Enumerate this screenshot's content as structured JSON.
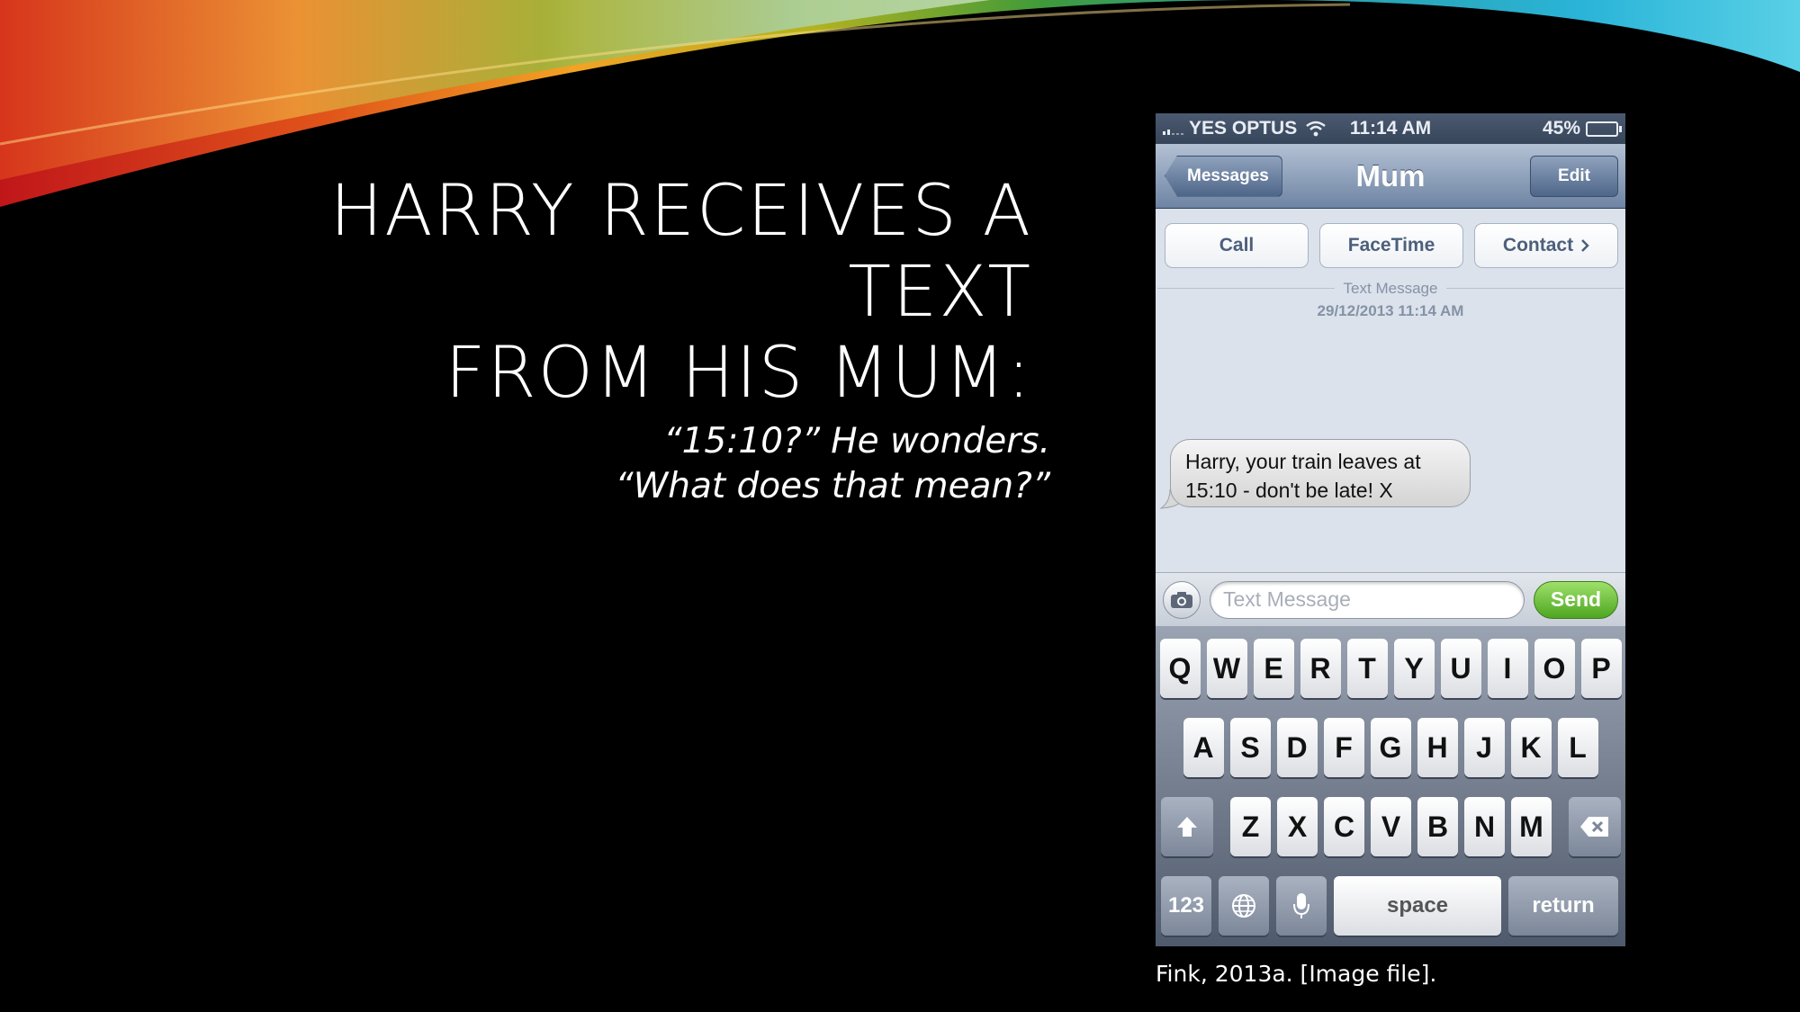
{
  "slide": {
    "title_lines": [
      "HARRY RECEIVES A TEXT",
      "FROM HIS MUM:"
    ],
    "quote_lines": [
      "“15:10?” He wonders.",
      "“What does that mean?”"
    ],
    "caption": "Fink, 2013a. [Image file]."
  },
  "phone": {
    "status": {
      "carrier": "YES OPTUS",
      "time": "11:14 AM",
      "battery": "45%",
      "battery_level": 0.45
    },
    "nav": {
      "back_label": "Messages",
      "title": "Mum",
      "edit_label": "Edit"
    },
    "actions": {
      "call": "Call",
      "facetime": "FaceTime",
      "contact": "Contact"
    },
    "thread": {
      "meta_label": "Text Message",
      "meta_date": "29/12/2013 11:14 AM",
      "message_lines": [
        "Harry, your train leaves at",
        "15:10 - don't be late! X"
      ]
    },
    "compose": {
      "placeholder": "Text Message",
      "value": "",
      "send_label": "Send"
    },
    "keyboard": {
      "row1": [
        "Q",
        "W",
        "E",
        "R",
        "T",
        "Y",
        "U",
        "I",
        "O",
        "P"
      ],
      "row2": [
        "A",
        "S",
        "D",
        "F",
        "G",
        "H",
        "J",
        "K",
        "L"
      ],
      "row3": [
        "Z",
        "X",
        "C",
        "V",
        "B",
        "N",
        "M"
      ],
      "numbers_label": "123",
      "space_label": "space",
      "return_label": "return"
    }
  },
  "colors": {
    "background": "#000000",
    "send_green": "#4ea621",
    "nav_blue": "#6e84a3"
  }
}
